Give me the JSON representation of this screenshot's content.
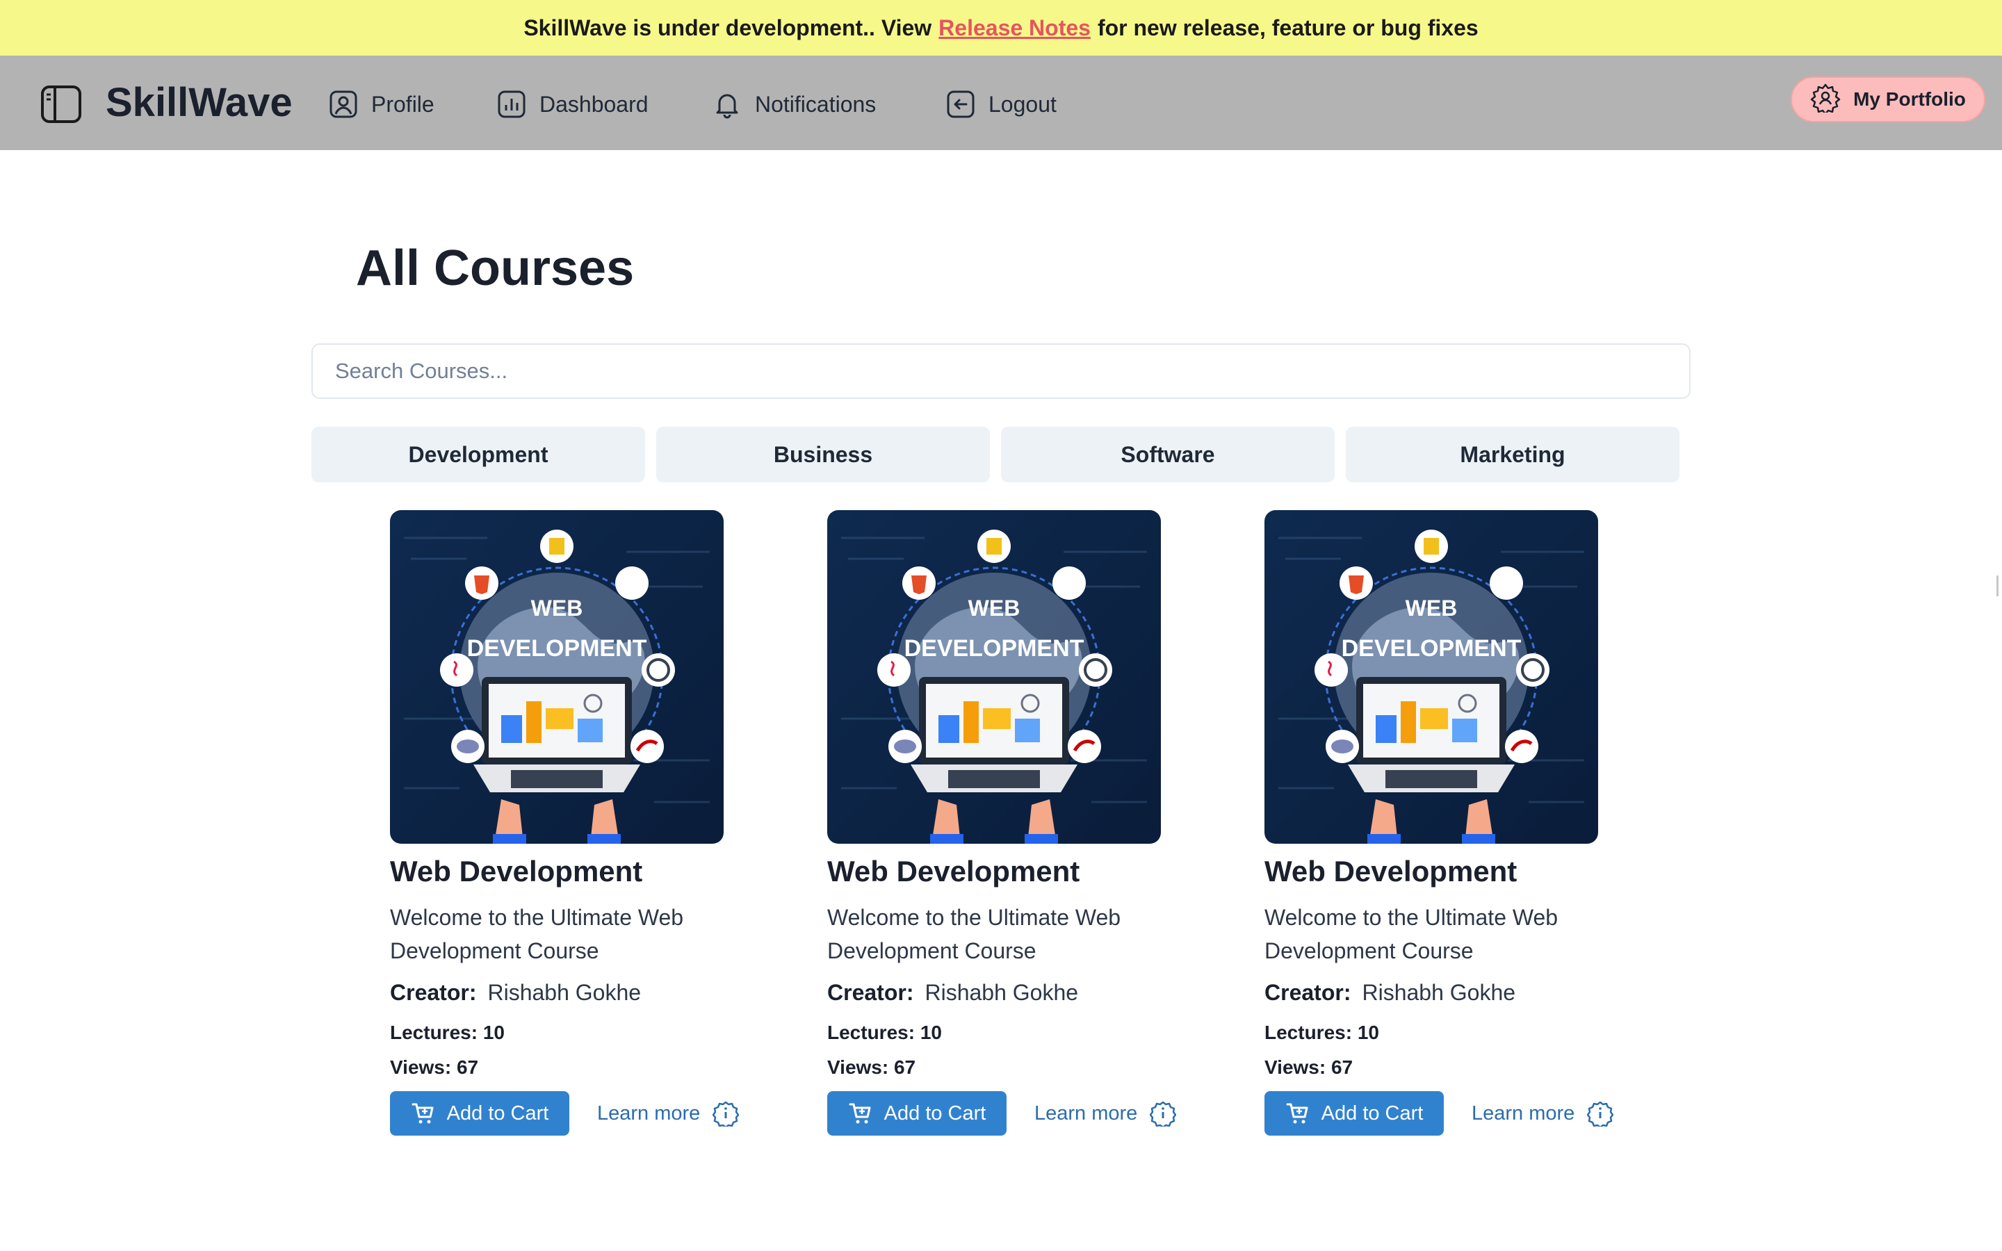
{
  "banner": {
    "prefix": "SkillWave is under development.. View",
    "link": "Release Notes",
    "suffix": "for new release, feature or bug fixes"
  },
  "nav": {
    "brand": "SkillWave",
    "items": [
      {
        "label": "Profile",
        "icon": "user-icon"
      },
      {
        "label": "Dashboard",
        "icon": "chart-icon"
      },
      {
        "label": "Notifications",
        "icon": "bell-icon"
      },
      {
        "label": "Logout",
        "icon": "logout-icon"
      }
    ],
    "portfolio": {
      "label": "My Portfolio",
      "icon": "gear-icon"
    }
  },
  "page": {
    "title": "All Courses",
    "search_placeholder": "Search Courses..."
  },
  "categories": [
    "Development",
    "Business",
    "Software",
    "Marketing"
  ],
  "courses": [
    {
      "title": "Web Development",
      "description": "Welcome to the Ultimate Web Development Course",
      "creator_label": "Creator:",
      "creator": "Rishabh Gokhe",
      "lectures": "Lectures: 10",
      "views": "Views: 67",
      "cart_label": "Add to Cart",
      "learn_label": "Learn more",
      "thumb_text": [
        "WEB",
        "DEVELOPMENT"
      ]
    },
    {
      "title": "Web Development",
      "description": "Welcome to the Ultimate Web Development Course",
      "creator_label": "Creator:",
      "creator": "Rishabh Gokhe",
      "lectures": "Lectures: 10",
      "views": "Views: 67",
      "cart_label": "Add to Cart",
      "learn_label": "Learn more",
      "thumb_text": [
        "WEB",
        "DEVELOPMENT"
      ]
    },
    {
      "title": "Web Development",
      "description": "Welcome to the Ultimate Web Development Course",
      "creator_label": "Creator:",
      "creator": "Rishabh Gokhe",
      "lectures": "Lectures: 10",
      "views": "Views: 67",
      "cart_label": "Add to Cart",
      "learn_label": "Learn more",
      "thumb_text": [
        "WEB",
        "DEVELOPMENT"
      ]
    }
  ],
  "colors": {
    "banner_bg": "#f6f98a",
    "banner_link": "#e8535f",
    "navbar_bg": "#b3b3b3",
    "portfolio_bg": "#fdbcbc",
    "tab_bg": "#edf2f7",
    "primary": "#3182ce",
    "link": "#2b6cb0"
  }
}
